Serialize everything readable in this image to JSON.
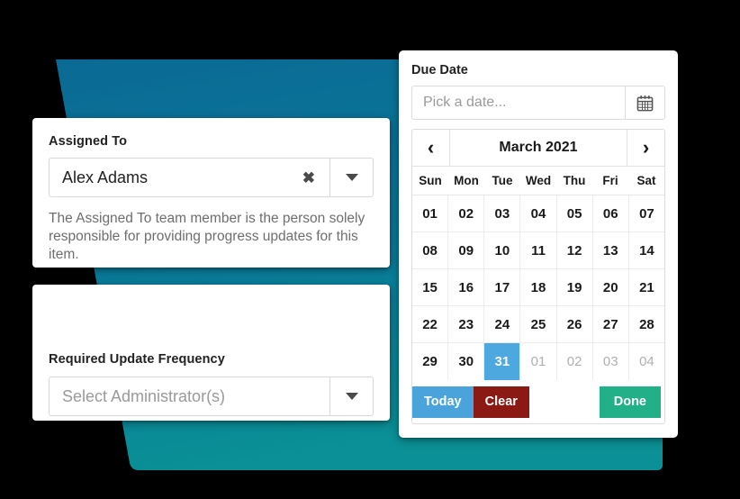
{
  "theme": {
    "background": "#000000",
    "slab_top_color": "#0a6a94",
    "slab_bottom_color": "#0a8a96",
    "accent_blue": "#4ba3dc",
    "accent_red": "#8b1a14",
    "accent_green": "#21b088",
    "selected_day_bg": "#4ea8e0"
  },
  "assigned_to": {
    "label": "Assigned To",
    "selected_value": "Alex Adams",
    "clear_icon": "clear-x-icon",
    "dropdown_icon": "chevron-down-icon",
    "help_text": "The Assigned To team member is the person solely responsible for providing progress updates for this item."
  },
  "update_frequency": {
    "label": "Required Update Frequency",
    "placeholder": "Select Administrator(s)",
    "selected_value": "",
    "dropdown_icon": "chevron-down-icon"
  },
  "due_date": {
    "label": "Due Date",
    "input_placeholder": "Pick a date...",
    "input_value": "",
    "calendar_icon": "calendar-icon",
    "calendar": {
      "prev_icon": "chevron-left-icon",
      "next_icon": "chevron-right-icon",
      "title": "March 2021",
      "month": "March",
      "year": "2021",
      "day_headers": [
        "Sun",
        "Mon",
        "Tue",
        "Wed",
        "Thu",
        "Fri",
        "Sat"
      ],
      "selected_day": "31",
      "weeks": [
        [
          {
            "d": "01",
            "muted": false
          },
          {
            "d": "02",
            "muted": false
          },
          {
            "d": "03",
            "muted": false
          },
          {
            "d": "04",
            "muted": false
          },
          {
            "d": "05",
            "muted": false
          },
          {
            "d": "06",
            "muted": false
          },
          {
            "d": "07",
            "muted": false
          }
        ],
        [
          {
            "d": "08",
            "muted": false
          },
          {
            "d": "09",
            "muted": false
          },
          {
            "d": "10",
            "muted": false
          },
          {
            "d": "11",
            "muted": false
          },
          {
            "d": "12",
            "muted": false
          },
          {
            "d": "13",
            "muted": false
          },
          {
            "d": "14",
            "muted": false
          }
        ],
        [
          {
            "d": "15",
            "muted": false
          },
          {
            "d": "16",
            "muted": false
          },
          {
            "d": "17",
            "muted": false
          },
          {
            "d": "18",
            "muted": false
          },
          {
            "d": "19",
            "muted": false
          },
          {
            "d": "20",
            "muted": false
          },
          {
            "d": "21",
            "muted": false
          }
        ],
        [
          {
            "d": "22",
            "muted": false
          },
          {
            "d": "23",
            "muted": false
          },
          {
            "d": "24",
            "muted": false
          },
          {
            "d": "25",
            "muted": false
          },
          {
            "d": "26",
            "muted": false
          },
          {
            "d": "27",
            "muted": false
          },
          {
            "d": "28",
            "muted": false
          }
        ],
        [
          {
            "d": "29",
            "muted": false
          },
          {
            "d": "30",
            "muted": false
          },
          {
            "d": "31",
            "muted": false,
            "selected": true
          },
          {
            "d": "01",
            "muted": true
          },
          {
            "d": "02",
            "muted": true
          },
          {
            "d": "03",
            "muted": true
          },
          {
            "d": "04",
            "muted": true
          }
        ]
      ]
    },
    "buttons": {
      "today": "Today",
      "clear": "Clear",
      "done": "Done"
    }
  }
}
